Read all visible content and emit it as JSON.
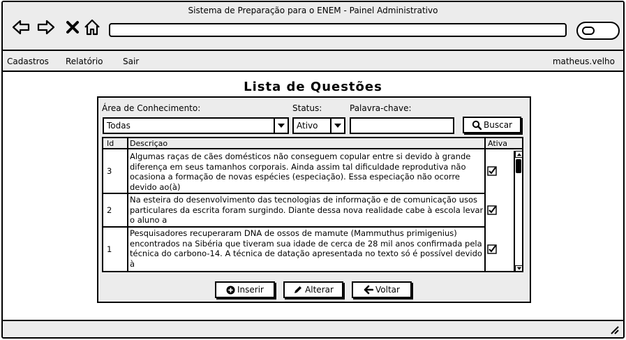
{
  "window": {
    "title": "Sistema de Preparação para o ENEM - Painel Administrativo"
  },
  "menu": {
    "items": [
      "Cadastros",
      "Relatório",
      "Sair"
    ],
    "user": "matheus.velho"
  },
  "page": {
    "title": "Lista de Questões"
  },
  "filters": {
    "area_label": "Área de Conhecimento:",
    "area_value": "Todas",
    "status_label": "Status:",
    "status_value": "Ativo",
    "keyword_label": "Palavra-chave:",
    "keyword_value": "",
    "search_button": "Buscar"
  },
  "table": {
    "headers": {
      "id": "Id",
      "desc": "Descriçao",
      "active": "Ativa"
    },
    "rows": [
      {
        "id": "3",
        "desc": "Algumas raças de cães domésticos não conseguem copular entre si devido à grande diferença em seus tamanhos corporais. Ainda assim tal dificuldade reprodutiva não ocasiona a formação de novas espécies (especiação). Essa especiação não ocorre devido ao(à)",
        "active": true
      },
      {
        "id": "2",
        "desc": "Na esteira do desenvolvimento das tecnologias de informação e de comunicação usos particulares da escrita foram surgindo. Diante dessa nova realidade cabe à escola levar o aluno a",
        "active": true
      },
      {
        "id": "1",
        "desc": "Pesquisadores recuperaram DNA de ossos de mamute (Mammuthus primigenius) encontrados na Sibéria que tiveram sua idade de cerca de 28 mil anos confirmada pela técnica do carbono-14. A técnica de datação apresentada no texto só é possível devido à",
        "active": true
      }
    ]
  },
  "actions": {
    "insert": "Inserir",
    "edit": "Alterar",
    "back": "Voltar"
  }
}
